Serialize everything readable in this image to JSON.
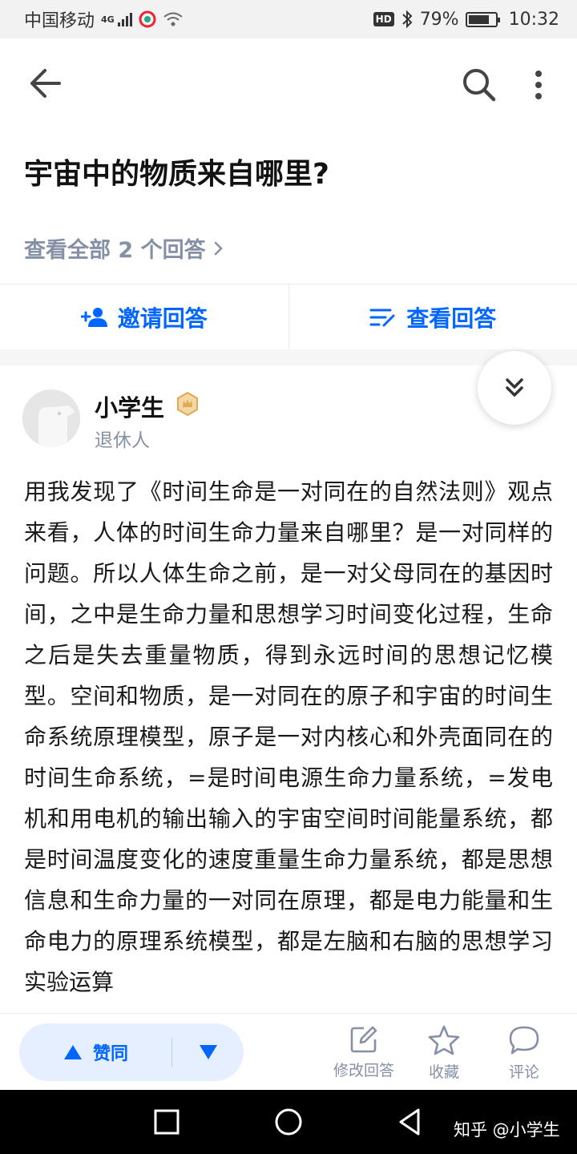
{
  "status_bar": {
    "carrier": "中国移动",
    "network": "4G",
    "hd_label": "HD",
    "battery": "79%",
    "battery_level": 0.79,
    "time": "10:32"
  },
  "question": {
    "title": "宇宙中的物质来自哪里?",
    "view_all": "查看全部 2 个回答"
  },
  "actions": {
    "invite": "邀请回答",
    "view": "查看回答"
  },
  "answer": {
    "author_name": "小学生",
    "author_bio": "退休人",
    "content": "用我发现了《时间生命是一对同在的自然法则》观点来看，人体的时间生命力量来自哪里？是一对同样的问题。所以人体生命之前，是一对父母同在的基因时间，之中是生命力量和思想学习时间变化过程，生命之后是失去重量物质，得到永远时间的思想记忆模型。空间和物质，是一对同在的原子和宇宙的时间生命系统原理模型，原子是一对内核心和外壳面同在的时间生命系统，=是时间电源生命力量系统，=发电机和用电机的输出输入的宇宙空间时间能量系统，都是时间温度变化的速度重量生命力量系统，都是思想信息和生命力量的一对同在原理，都是电力能量和生命电力的原理系统模型，都是左脑和右脑的思想学习实验运算"
  },
  "bottom_bar": {
    "upvote": "赞同",
    "edit": "修改回答",
    "favorite": "收藏",
    "comment": "评论"
  },
  "watermark": "知乎 @小学生",
  "colors": {
    "accent": "#0066ff",
    "accent_bg": "#e5efff",
    "muted": "#8590a6",
    "badge": "#e0a852"
  }
}
